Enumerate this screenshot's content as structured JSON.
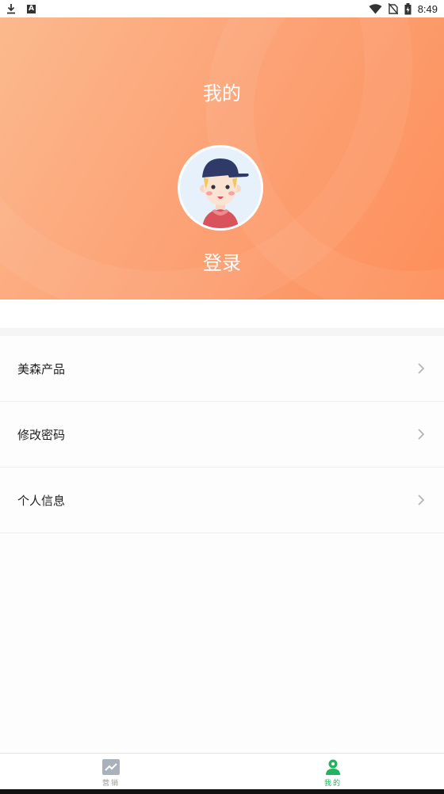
{
  "status_bar": {
    "time": "8:49",
    "left_icons": [
      "download-icon",
      "a-icon"
    ],
    "right_icons": [
      "wifi-icon",
      "no-sim-icon",
      "battery-charging-icon"
    ]
  },
  "header": {
    "title": "我的",
    "login_label": "登录",
    "gradient_colors": [
      "#fbb98c",
      "#fd8f5a"
    ]
  },
  "menu": {
    "items": [
      {
        "label": "美森产品",
        "icon": "chevron-right-icon"
      },
      {
        "label": "修改密码",
        "icon": "chevron-right-icon"
      },
      {
        "label": "个人信息",
        "icon": "chevron-right-icon"
      }
    ]
  },
  "tab_bar": {
    "tabs": [
      {
        "label": "营销",
        "icon": "chart-icon",
        "active": false
      },
      {
        "label": "我的",
        "icon": "user-icon",
        "active": true
      }
    ],
    "active_color": "#21b35d",
    "inactive_color": "#999999"
  }
}
